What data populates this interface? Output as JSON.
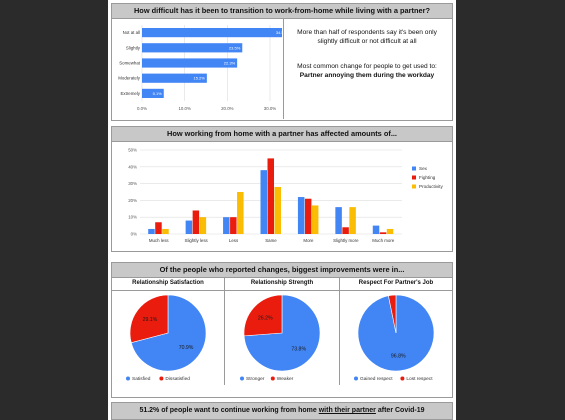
{
  "section1": {
    "title": "How difficult has it been to transition to work-from-home while living with a partner?",
    "note1": "More than half of respondents say it's been only slightly difficult or not difficult at all",
    "note2_line1": "Most common change for people to get used to:",
    "note2_line2": "Partner annoying them during the workday"
  },
  "section2": {
    "title": "How working from home with a partner has affected amounts of..."
  },
  "section3": {
    "title": "Of the people who reported changes, biggest improvements were in..."
  },
  "footer": {
    "prefix": "51.2% of people want to continue working from home ",
    "highlight": "with their partner",
    "suffix": " after Covid-19"
  },
  "colors": {
    "blue": "#4285f4",
    "red": "#ea1c0e",
    "yellow": "#fbbc04",
    "gray_header": "#c8c8c8"
  },
  "chart_data": [
    {
      "type": "bar",
      "orientation": "horizontal",
      "categories": [
        "Not at all",
        "Slightly",
        "Somewhat",
        "Moderately",
        "Extremely"
      ],
      "values": [
        34.5,
        23.5,
        22.3,
        15.2,
        5.1
      ],
      "value_labels": [
        "34.5%",
        "23.5%",
        "22.3%",
        "15.2%",
        "5.1%"
      ],
      "xlim": [
        0,
        30
      ],
      "xticks": [
        "0.0%",
        "10.0%",
        "20.0%",
        "30.0%"
      ],
      "grid": true
    },
    {
      "type": "bar",
      "categories": [
        "Much less",
        "Slightly less",
        "Less",
        "Same",
        "More",
        "Slightly more",
        "Much more"
      ],
      "series": [
        {
          "name": "Sex",
          "values": [
            3,
            8,
            10,
            38,
            22,
            16,
            5
          ]
        },
        {
          "name": "Fighting",
          "values": [
            7,
            14,
            10,
            45,
            21,
            4,
            1
          ]
        },
        {
          "name": "Productivity",
          "values": [
            3,
            10,
            25,
            28,
            17,
            16,
            3
          ]
        }
      ],
      "ylim": [
        0,
        50
      ],
      "yticks": [
        "0%",
        "10%",
        "20%",
        "30%",
        "40%",
        "50%"
      ],
      "legend": "right",
      "grid": true
    },
    {
      "type": "pie",
      "title": "Relationship Satisfaction",
      "labels": [
        "Satisfied",
        "Dissatisfied"
      ],
      "values": [
        70.9,
        29.1
      ],
      "value_labels": [
        "70.9%",
        "29.1%"
      ],
      "legend": "bottom"
    },
    {
      "type": "pie",
      "title": "Relationship Strength",
      "labels": [
        "Stronger",
        "Weaker"
      ],
      "values": [
        73.8,
        26.2
      ],
      "value_labels": [
        "73.8%",
        "26.2%"
      ],
      "legend": "bottom"
    },
    {
      "type": "pie",
      "title": "Respect For Partner's Job",
      "labels": [
        "Gained respect",
        "Lost respect"
      ],
      "values": [
        96.8,
        3.2
      ],
      "value_labels": [
        "96.8%",
        ""
      ],
      "legend": "bottom"
    }
  ]
}
